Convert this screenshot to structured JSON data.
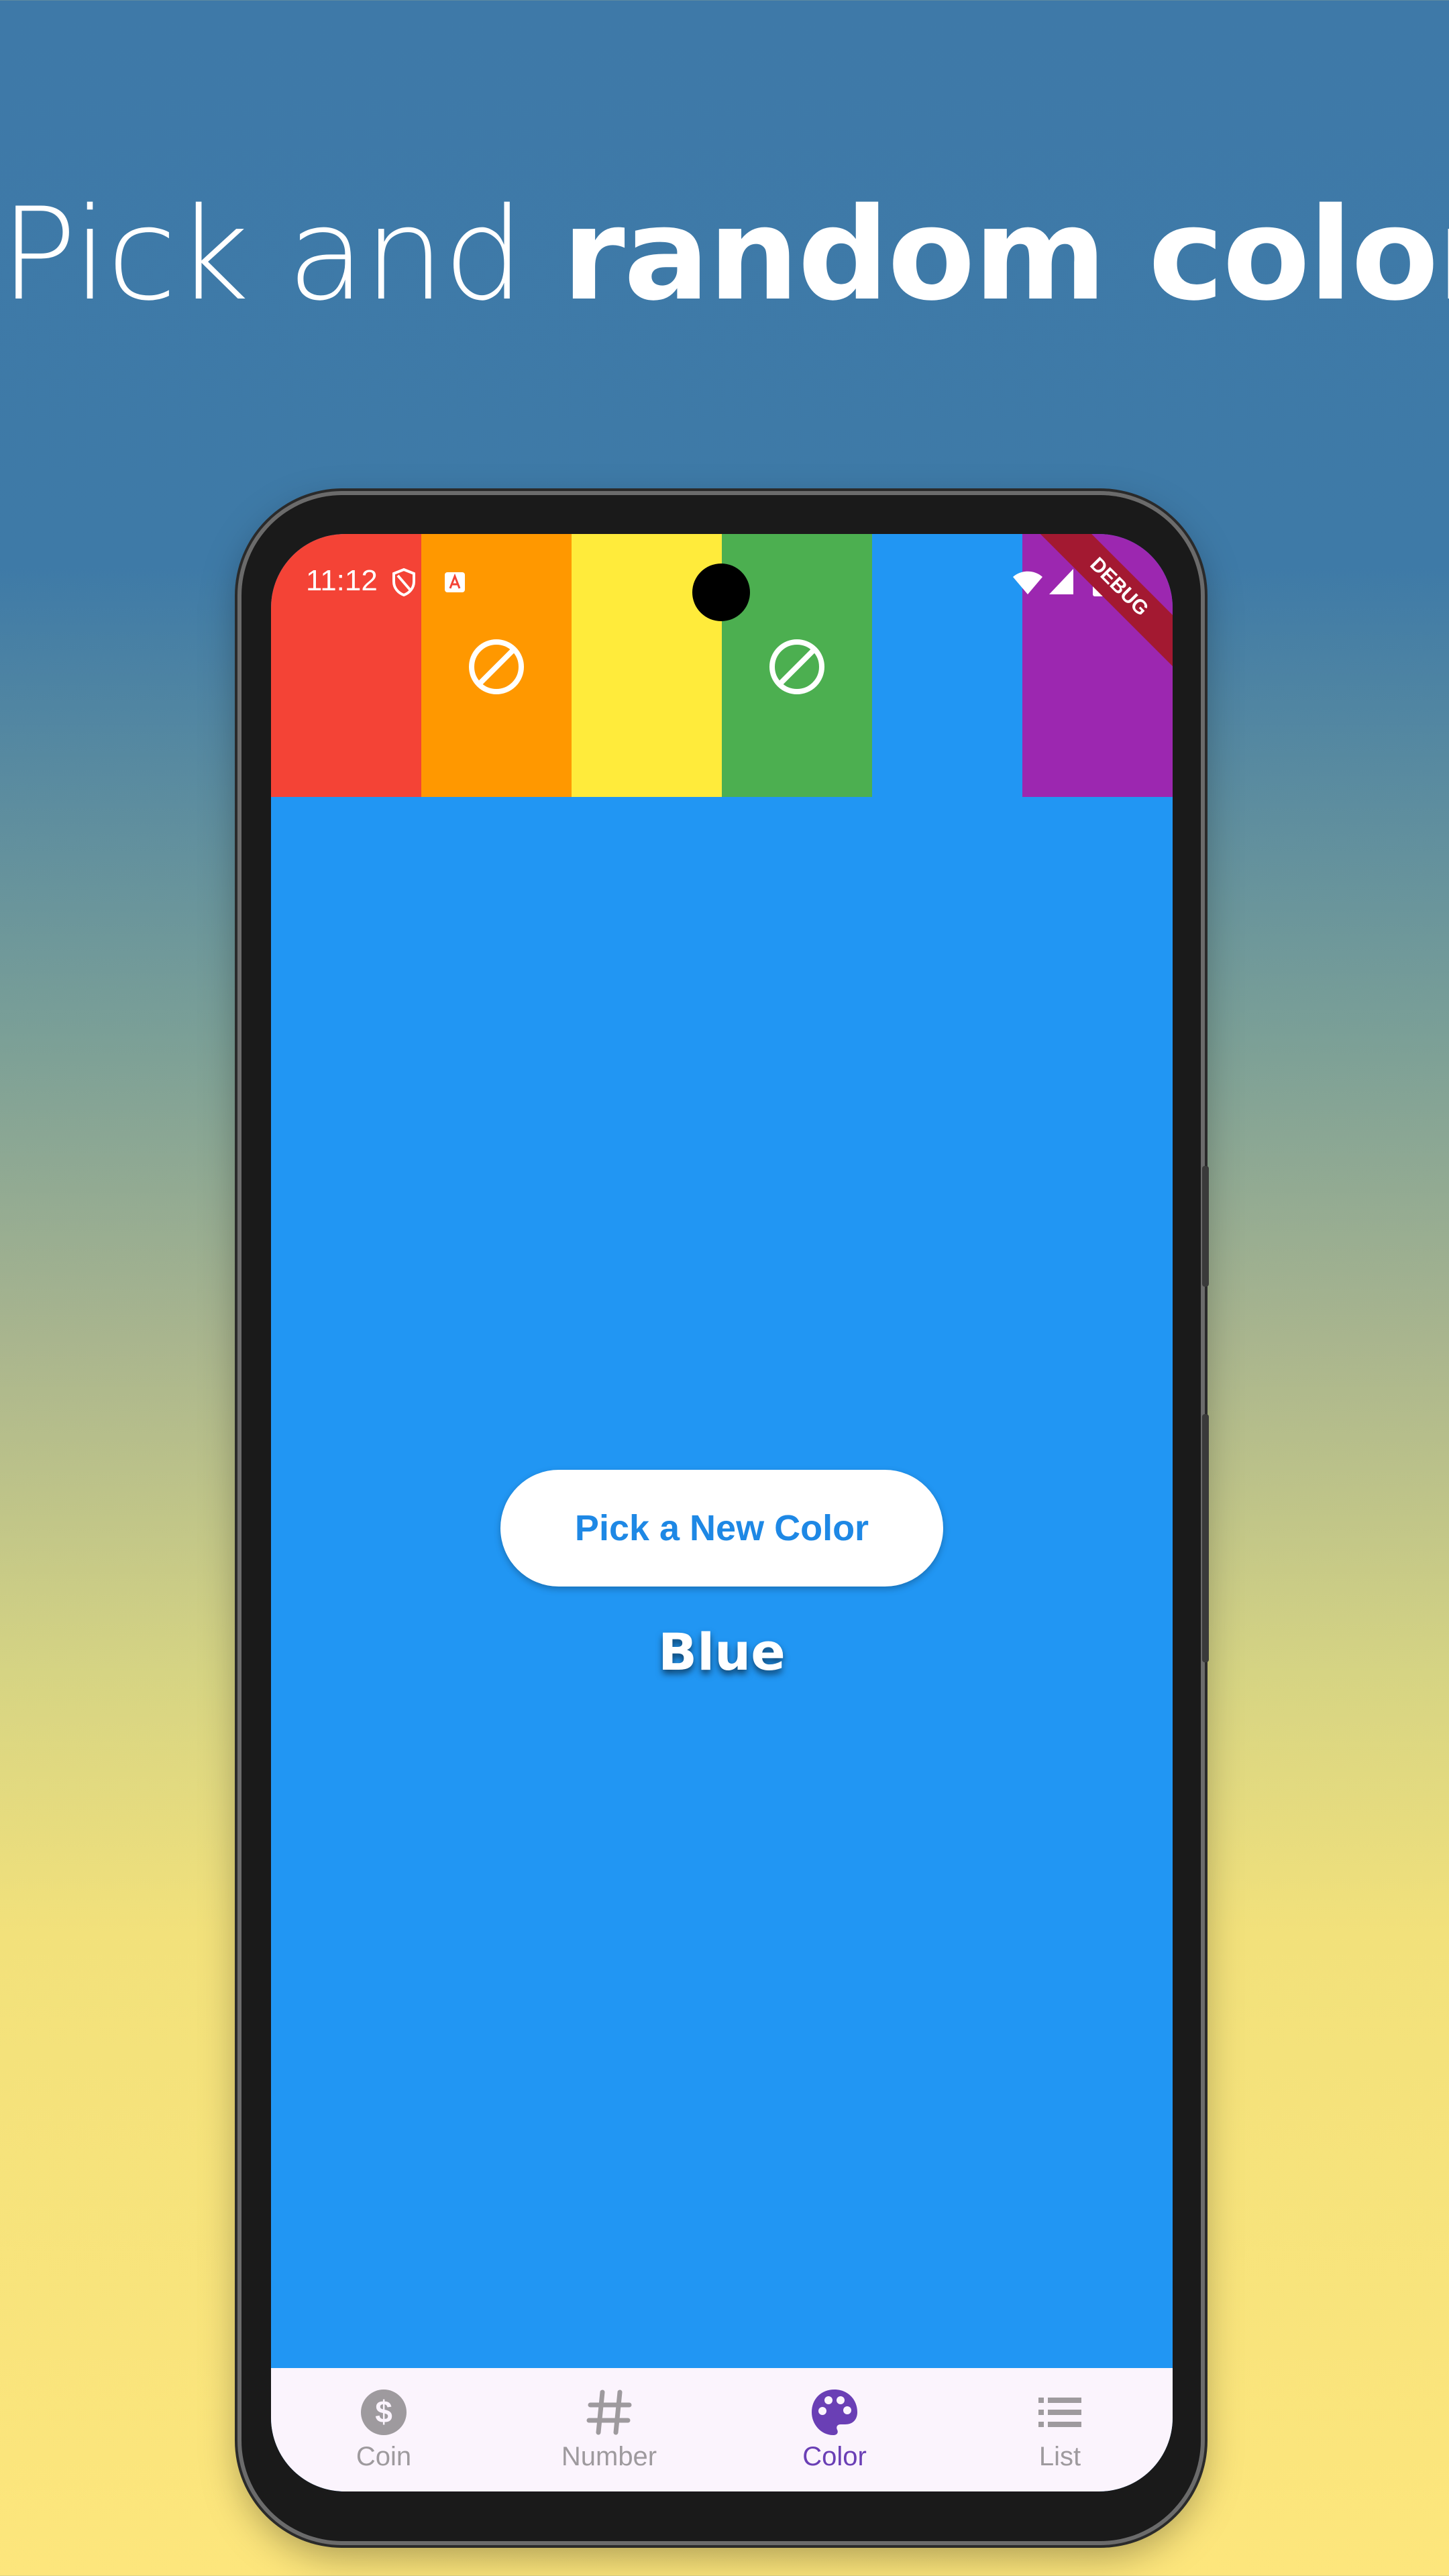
{
  "headline": {
    "light": "Pick and ",
    "bold": "random color"
  },
  "status_bar": {
    "time": "11:12"
  },
  "debug_banner": "DEBUG",
  "color_stripes": [
    {
      "name": "red",
      "color": "#F44336",
      "icon": null
    },
    {
      "name": "orange",
      "color": "#FF9800",
      "icon": "block-icon"
    },
    {
      "name": "yellow",
      "color": "#FFEB3B",
      "icon": null
    },
    {
      "name": "green",
      "color": "#4CAF50",
      "icon": "block-icon"
    },
    {
      "name": "blue",
      "color": "#2196F3",
      "icon": null
    },
    {
      "name": "purple",
      "color": "#9C27B0",
      "icon": null
    }
  ],
  "main": {
    "background": "#2196F3",
    "button_label": "Pick a New Color",
    "color_name": "Blue"
  },
  "bottom_nav": {
    "items": [
      {
        "label": "Coin",
        "icon": "dollar-icon",
        "active": false
      },
      {
        "label": "Number",
        "icon": "hash-icon",
        "active": false
      },
      {
        "label": "Color",
        "icon": "palette-icon",
        "active": true
      },
      {
        "label": "List",
        "icon": "list-icon",
        "active": false
      }
    ],
    "active_color": "#6a3fb5",
    "inactive_color": "#9e9a9e"
  }
}
